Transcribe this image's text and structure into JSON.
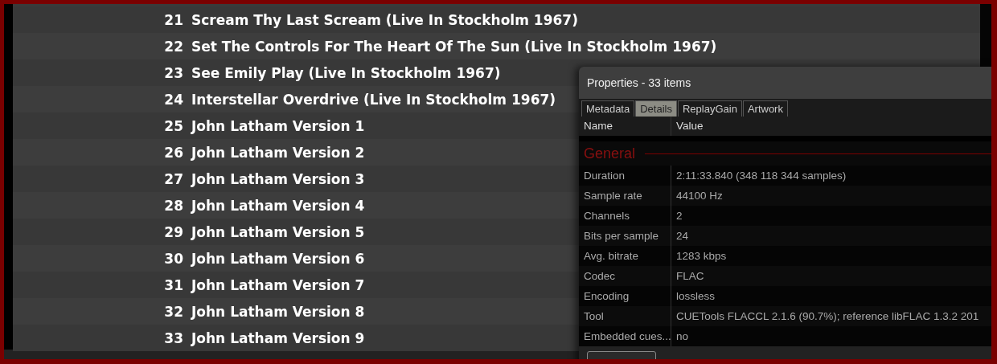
{
  "tracks": [
    {
      "number": "21",
      "title": "Scream Thy Last Scream (Live In Stockholm 1967)"
    },
    {
      "number": "22",
      "title": "Set The Controls For The Heart Of The Sun (Live In Stockholm 1967)"
    },
    {
      "number": "23",
      "title": "See Emily Play (Live In Stockholm 1967)"
    },
    {
      "number": "24",
      "title": "Interstellar Overdrive (Live In Stockholm 1967)"
    },
    {
      "number": "25",
      "title": "John Latham Version 1"
    },
    {
      "number": "26",
      "title": "John Latham Version 2"
    },
    {
      "number": "27",
      "title": "John Latham Version 3"
    },
    {
      "number": "28",
      "title": "John Latham Version 4"
    },
    {
      "number": "29",
      "title": "John Latham Version 5"
    },
    {
      "number": "30",
      "title": "John Latham Version 6"
    },
    {
      "number": "31",
      "title": "John Latham Version 7"
    },
    {
      "number": "32",
      "title": "John Latham Version 8"
    },
    {
      "number": "33",
      "title": "John Latham Version 9"
    }
  ],
  "properties_window": {
    "title": "Properties - 33 items",
    "tabs": [
      {
        "label": "Metadata",
        "selected": false
      },
      {
        "label": "Details",
        "selected": true
      },
      {
        "label": "ReplayGain",
        "selected": false
      },
      {
        "label": "Artwork",
        "selected": false
      }
    ],
    "columns": [
      "Name",
      "Value"
    ],
    "section": "General",
    "rows": [
      {
        "name": "Duration",
        "value": "2:11:33.840 (348 118 344 samples)"
      },
      {
        "name": "Sample rate",
        "value": "44100 Hz"
      },
      {
        "name": "Channels",
        "value": "2"
      },
      {
        "name": "Bits per sample",
        "value": "24"
      },
      {
        "name": "Avg. bitrate",
        "value": "1283 kbps"
      },
      {
        "name": "Codec",
        "value": "FLAC"
      },
      {
        "name": "Encoding",
        "value": "lossless"
      },
      {
        "name": "Tool",
        "value": "CUETools FLACCL 2.1.6 (90.7%); reference libFLAC 1.3.2 201"
      },
      {
        "name": "Embedded cues...",
        "value": "no"
      }
    ]
  }
}
